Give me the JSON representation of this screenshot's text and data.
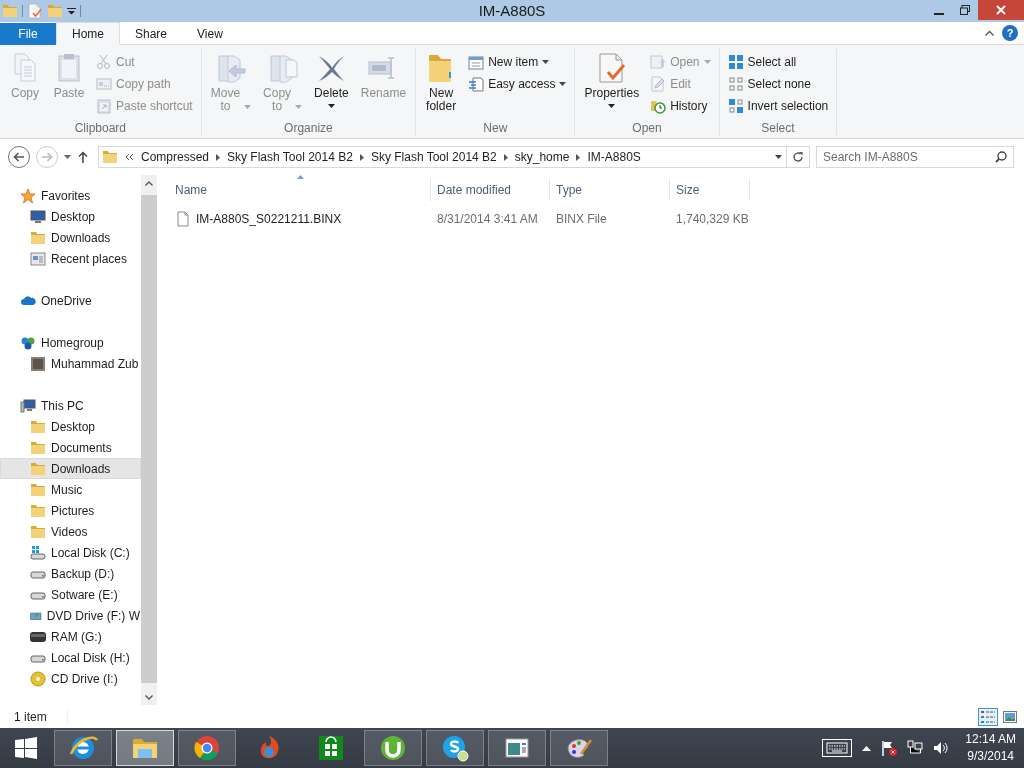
{
  "window": {
    "title": "IM-A880S"
  },
  "ribbon_tabs": [
    {
      "label": "File",
      "kind": "file",
      "selected": false
    },
    {
      "label": "Home",
      "kind": "tab",
      "selected": true
    },
    {
      "label": "Share",
      "kind": "tab",
      "selected": false
    },
    {
      "label": "View",
      "kind": "tab",
      "selected": false
    }
  ],
  "help_button": {
    "label": "?"
  },
  "ribbon_groups": [
    {
      "label": "Clipboard",
      "items": [
        {
          "label": "Copy",
          "kind": "large",
          "disabled": true
        },
        {
          "label": "Paste",
          "kind": "large",
          "disabled": true
        },
        {
          "label": "Cut",
          "kind": "small",
          "disabled": true
        },
        {
          "label": "Copy path",
          "kind": "small",
          "disabled": true
        },
        {
          "label": "Paste shortcut",
          "kind": "small",
          "disabled": true
        }
      ]
    },
    {
      "label": "Organize",
      "items": [
        {
          "label": "Move to",
          "kind": "large",
          "disabled": true,
          "dropdown": true,
          "dropdown_below": false
        },
        {
          "label": "Copy to",
          "kind": "large",
          "disabled": true,
          "dropdown": true,
          "dropdown_below": false
        },
        {
          "label": "Delete",
          "kind": "large",
          "disabled": false,
          "dropdown": true,
          "dropdown_below": true
        },
        {
          "label": "Rename",
          "kind": "large",
          "disabled": true,
          "dropdown": false
        }
      ]
    },
    {
      "label": "New",
      "items": [
        {
          "label": "New folder",
          "kind": "large",
          "disabled": false,
          "dropdown": false
        },
        {
          "label": "New item",
          "kind": "small",
          "disabled": false,
          "dropdown": true
        },
        {
          "label": "Easy access",
          "kind": "small",
          "disabled": false,
          "dropdown": true
        }
      ]
    },
    {
      "label": "Open",
      "items": [
        {
          "label": "Properties",
          "kind": "large",
          "disabled": false,
          "dropdown": true,
          "dropdown_below": true
        },
        {
          "label": "Open",
          "kind": "small",
          "disabled": true,
          "dropdown": true
        },
        {
          "label": "Edit",
          "kind": "small",
          "disabled": true,
          "dropdown": false
        },
        {
          "label": "History",
          "kind": "small",
          "disabled": false,
          "dropdown": false
        }
      ]
    },
    {
      "label": "Select",
      "items": [
        {
          "label": "Select all",
          "kind": "small",
          "disabled": false
        },
        {
          "label": "Select none",
          "kind": "small",
          "disabled": false
        },
        {
          "label": "Invert selection",
          "kind": "small",
          "disabled": false
        }
      ]
    }
  ],
  "navigation_buttons": {
    "back_disabled": false,
    "forward_disabled": true
  },
  "address_bar": {
    "segments": [
      "Compressed",
      "Sky Flash Tool 2014 B2",
      "Sky Flash Tool 2014 B2",
      "sky_home",
      "IM-A880S"
    ]
  },
  "search": {
    "placeholder": "Search IM-A880S"
  },
  "navigation_pane": [
    {
      "label": "Favorites",
      "selected": false,
      "children": [
        {
          "label": "Desktop",
          "selected": false
        },
        {
          "label": "Downloads",
          "selected": false
        },
        {
          "label": "Recent places",
          "selected": false
        }
      ]
    },
    {
      "label": "OneDrive",
      "selected": false
    },
    {
      "label": "Homegroup",
      "selected": false,
      "children": [
        {
          "label": "Muhammad Zub",
          "selected": false
        }
      ]
    },
    {
      "label": "This PC",
      "selected": false,
      "children": [
        {
          "label": "Desktop",
          "selected": false
        },
        {
          "label": "Documents",
          "selected": false
        },
        {
          "label": "Downloads",
          "selected": true
        },
        {
          "label": "Music",
          "selected": false
        },
        {
          "label": "Pictures",
          "selected": false
        },
        {
          "label": "Videos",
          "selected": false
        },
        {
          "label": "Local Disk (C:)",
          "selected": false
        },
        {
          "label": "Backup (D:)",
          "selected": false
        },
        {
          "label": "Sotware (E:)",
          "selected": false
        },
        {
          "label": "DVD Drive (F:) W",
          "selected": false
        },
        {
          "label": "RAM (G:)",
          "selected": false
        },
        {
          "label": "Local Disk (H:)",
          "selected": false
        },
        {
          "label": "CD Drive (I:)",
          "selected": false
        }
      ]
    }
  ],
  "file_list": {
    "columns": [
      {
        "label": "Name",
        "sorted": true
      },
      {
        "label": "Date modified",
        "sorted": false
      },
      {
        "label": "Type",
        "sorted": false
      },
      {
        "label": "Size",
        "sorted": false
      }
    ],
    "rows": [
      {
        "name": "IM-A880S_S0221211.BINX",
        "date_modified": "8/31/2014 3:41 AM",
        "type": "BINX File",
        "size": "1,740,329 KB",
        "selected": false
      }
    ]
  },
  "status_bar": {
    "item_count": "1 item",
    "view_buttons": [
      {
        "kind": "details",
        "selected": true
      },
      {
        "kind": "large-icons",
        "selected": false
      }
    ]
  },
  "taskbar": {
    "apps": [
      {
        "running": true,
        "active": false
      },
      {
        "running": true,
        "active": true
      },
      {
        "running": true,
        "active": false
      },
      {
        "running": false,
        "active": false
      },
      {
        "running": false,
        "active": false
      },
      {
        "running": true,
        "active": false
      },
      {
        "running": true,
        "active": false
      },
      {
        "running": true,
        "active": false
      },
      {
        "running": true,
        "active": false
      }
    ],
    "clock": {
      "time": "12:14 AM",
      "date": "9/3/2014"
    }
  }
}
